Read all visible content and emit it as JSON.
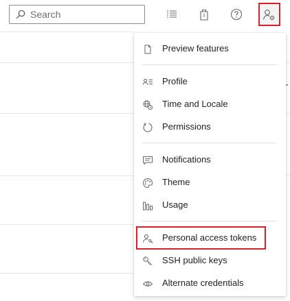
{
  "search": {
    "placeholder": "Search",
    "value": ""
  },
  "toolbar": {
    "icons": [
      "list-icon",
      "shopping-bag-icon",
      "help-icon",
      "user-settings-icon"
    ]
  },
  "menu": {
    "preview_features": "Preview features",
    "profile": "Profile",
    "time_locale": "Time and Locale",
    "permissions": "Permissions",
    "notifications": "Notifications",
    "theme": "Theme",
    "usage": "Usage",
    "personal_access_tokens": "Personal access tokens",
    "ssh_keys": "SSH public keys",
    "alternate_credentials": "Alternate credentials"
  },
  "colors": {
    "highlight": "#d8202a",
    "icon": "#666666"
  }
}
